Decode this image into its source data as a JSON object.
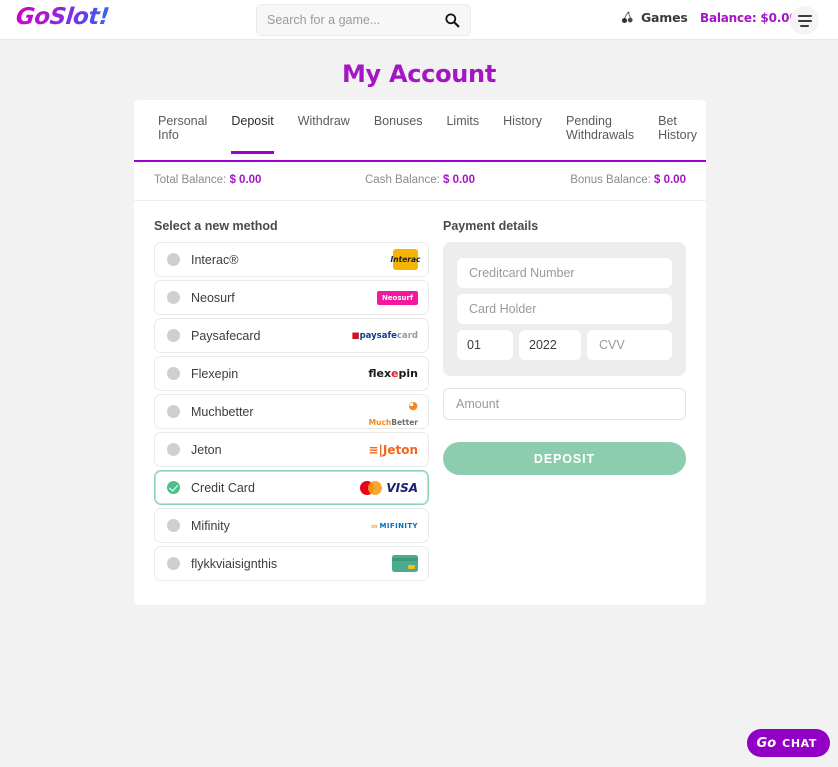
{
  "header": {
    "logo_text": "GoSlot!",
    "search": {
      "placeholder": "Search for a game...",
      "value": "",
      "icon": "search-icon"
    },
    "games_label": "Games",
    "games_icon": "cherries-icon",
    "balance_label": "Balance: $0.00",
    "menu_icon": "hamburger-menu-icon"
  },
  "page": {
    "title": "My Account"
  },
  "tabs": [
    {
      "label": "Personal\nInfo",
      "active": false
    },
    {
      "label": "Deposit",
      "active": true
    },
    {
      "label": "Withdraw",
      "active": false
    },
    {
      "label": "Bonuses",
      "active": false
    },
    {
      "label": "Limits",
      "active": false
    },
    {
      "label": "History",
      "active": false
    },
    {
      "label": "Pending\nWithdrawals",
      "active": false
    },
    {
      "label": "Bet\nHistory",
      "active": false
    }
  ],
  "balances": [
    {
      "label": "Total Balance:",
      "value": "$ 0.00"
    },
    {
      "label": "Cash Balance:",
      "value": "$ 0.00"
    },
    {
      "label": "Bonus Balance:",
      "value": "$ 0.00"
    }
  ],
  "methods_section": {
    "title": "Select a new method"
  },
  "methods": [
    {
      "label": "Interac®",
      "selected": false,
      "logo": "interac-logo",
      "logo_text": "Interac"
    },
    {
      "label": "Neosurf",
      "selected": false,
      "logo": "neosurf-logo",
      "logo_text": "Neosurf"
    },
    {
      "label": "Paysafecard",
      "selected": false,
      "logo": "paysafecard-logo",
      "logo_text": "paysafecard"
    },
    {
      "label": "Flexepin",
      "selected": false,
      "logo": "flexepin-logo",
      "logo_text": "flexepin"
    },
    {
      "label": "Muchbetter",
      "selected": false,
      "logo": "muchbetter-logo",
      "logo_text": "MuchBetter"
    },
    {
      "label": "Jeton",
      "selected": false,
      "logo": "jeton-logo",
      "logo_text": "Jeton"
    },
    {
      "label": "Credit Card",
      "selected": true,
      "logo": "mastercard-visa-logo",
      "logo_text": "VISA"
    },
    {
      "label": "Mifinity",
      "selected": false,
      "logo": "mifinity-logo",
      "logo_text": "MIFINITY"
    },
    {
      "label": "flykkviaisignthis",
      "selected": false,
      "logo": "credit-card-icon",
      "logo_text": ""
    }
  ],
  "payment": {
    "title": "Payment details",
    "card_number_placeholder": "Creditcard Number",
    "card_number_value": "",
    "card_holder_placeholder": "Card Holder",
    "card_holder_value": "",
    "exp_month": "01",
    "exp_year": "2022",
    "cvv_placeholder": "CVV",
    "cvv_value": "",
    "amount_placeholder": "Amount",
    "amount_value": "",
    "deposit_label": "DEPOSIT"
  },
  "chat": {
    "go": "Go",
    "label": "CHAT"
  },
  "colors": {
    "brand_purple": "#a415c4",
    "tab_underline": "#9c00d4",
    "selected_green": "#4cbf8b",
    "deposit_green": "#8ccdaf",
    "page_bg": "#f2f2f2"
  }
}
